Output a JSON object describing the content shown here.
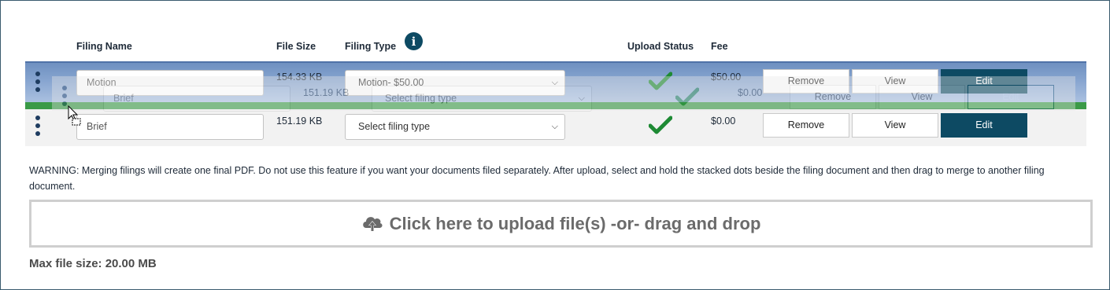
{
  "headers": {
    "filing_name": "Filing Name",
    "file_size": "File Size",
    "filing_type": "Filing Type",
    "upload_status": "Upload Status",
    "fee": "Fee"
  },
  "info_icon": {
    "icon": "info-icon",
    "glyph": "i"
  },
  "rows": [
    {
      "name": "Motion",
      "size": "154.33 KB",
      "type": "Motion- $50.00",
      "status": "uploaded",
      "fee": "$0.00"
    },
    {
      "name": "Brief",
      "size": "151.19 KB",
      "type": "Select filing type",
      "status": "uploaded",
      "fee": "$0.00"
    }
  ],
  "row1_fee": "$50.00",
  "buttons": {
    "remove": "Remove",
    "view": "View",
    "edit": "Edit"
  },
  "drag_ghost": {
    "name": "Brief",
    "size": "151.19 KB",
    "type": "Select filing type",
    "fee": "$0.00",
    "remove": "Remove",
    "view": "View",
    "edit": "Edit"
  },
  "warning": "WARNING: Merging filings will create one final PDF. Do not use this feature if you want your documents filed separately. After upload, select and hold the stacked dots beside the filing document and then drag to merge to another filing document.",
  "upload": {
    "label": "Click here to upload file(s) -or- drag and drop",
    "icon": "cloud-upload-icon"
  },
  "max_size": "Max file size: 20.00 MB",
  "colors": {
    "accent": "#0d4a63",
    "drop_highlight": "#3a9a47",
    "row_selected": "#87a5d0",
    "check": "#1e8a34"
  }
}
